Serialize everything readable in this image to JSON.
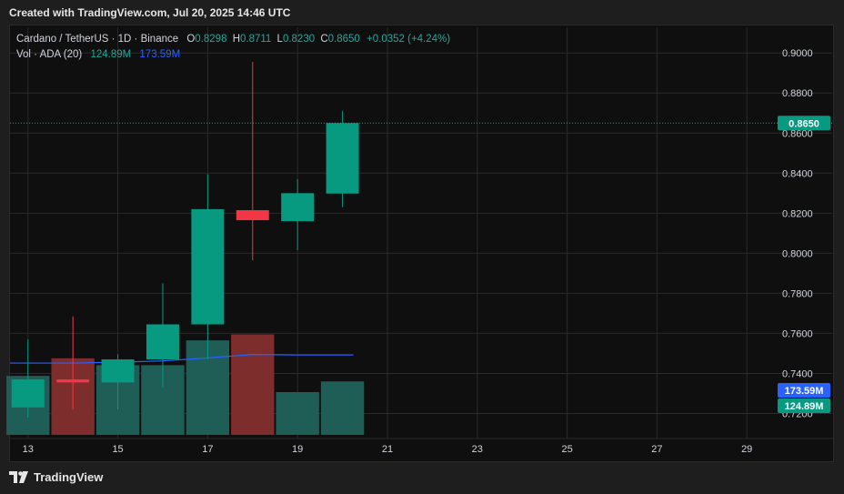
{
  "caption": "Created with TradingView.com, Jul 20, 2025 14:46 UTC",
  "brand": "TradingView",
  "legend": {
    "symbol": "Cardano / TetherUS · 1D · Binance",
    "o_label": "O",
    "o_value": "0.8298",
    "h_label": "H",
    "h_value": "0.8711",
    "l_label": "L",
    "l_value": "0.8230",
    "c_label": "C",
    "c_value": "0.8650",
    "change": "+0.0352 (+4.24%)",
    "vol_label": "Vol · ADA (20)",
    "vol_value": "124.89M",
    "vol_ma_value": "173.59M"
  },
  "badges": {
    "last_price": "0.8650",
    "vol_ma": "173.59M",
    "vol": "124.89M"
  },
  "colors": {
    "up": "#26a69a",
    "down": "#ef5350",
    "up_body": "#089981",
    "down_body": "#f23645",
    "vol_up": "#1f5e57",
    "vol_down": "#7d2d2c",
    "ma_line": "#2962ff",
    "grid": "#2a2a2a"
  },
  "chart_data": {
    "type": "candlestick",
    "y_ticks": [
      "0.9000",
      "0.8800",
      "0.8600",
      "0.8400",
      "0.8200",
      "0.8000",
      "0.7800",
      "0.7600",
      "0.7400",
      "0.7200"
    ],
    "ylim": [
      0.7075,
      0.906
    ],
    "x_ticks": [
      "13",
      "15",
      "17",
      "19",
      "21",
      "23",
      "25",
      "27",
      "29"
    ],
    "x_tick_days": [
      13,
      15,
      17,
      19,
      21,
      23,
      25,
      27,
      29
    ],
    "xlim": [
      12.6,
      31.0
    ],
    "candles": [
      {
        "day": 13,
        "open": 0.723,
        "high": 0.757,
        "low": 0.718,
        "close": 0.737
      },
      {
        "day": 14,
        "open": 0.737,
        "high": 0.7685,
        "low": 0.722,
        "close": 0.7355
      },
      {
        "day": 15,
        "open": 0.7355,
        "high": 0.7495,
        "low": 0.722,
        "close": 0.747
      },
      {
        "day": 16,
        "open": 0.747,
        "high": 0.785,
        "low": 0.733,
        "close": 0.7645
      },
      {
        "day": 17,
        "open": 0.7645,
        "high": 0.8395,
        "low": 0.747,
        "close": 0.822
      },
      {
        "day": 18,
        "open": 0.8215,
        "high": 0.8955,
        "low": 0.7965,
        "close": 0.8165
      },
      {
        "day": 19,
        "open": 0.816,
        "high": 0.837,
        "low": 0.8015,
        "close": 0.83
      },
      {
        "day": 20,
        "open": 0.8298,
        "high": 0.8711,
        "low": 0.823,
        "close": 0.865
      }
    ],
    "volume_m": [
      138,
      179,
      163,
      163,
      221,
      235,
      100,
      125
    ],
    "volume_ma_m": [
      168,
      168,
      170,
      173,
      180,
      188,
      187,
      187
    ]
  }
}
